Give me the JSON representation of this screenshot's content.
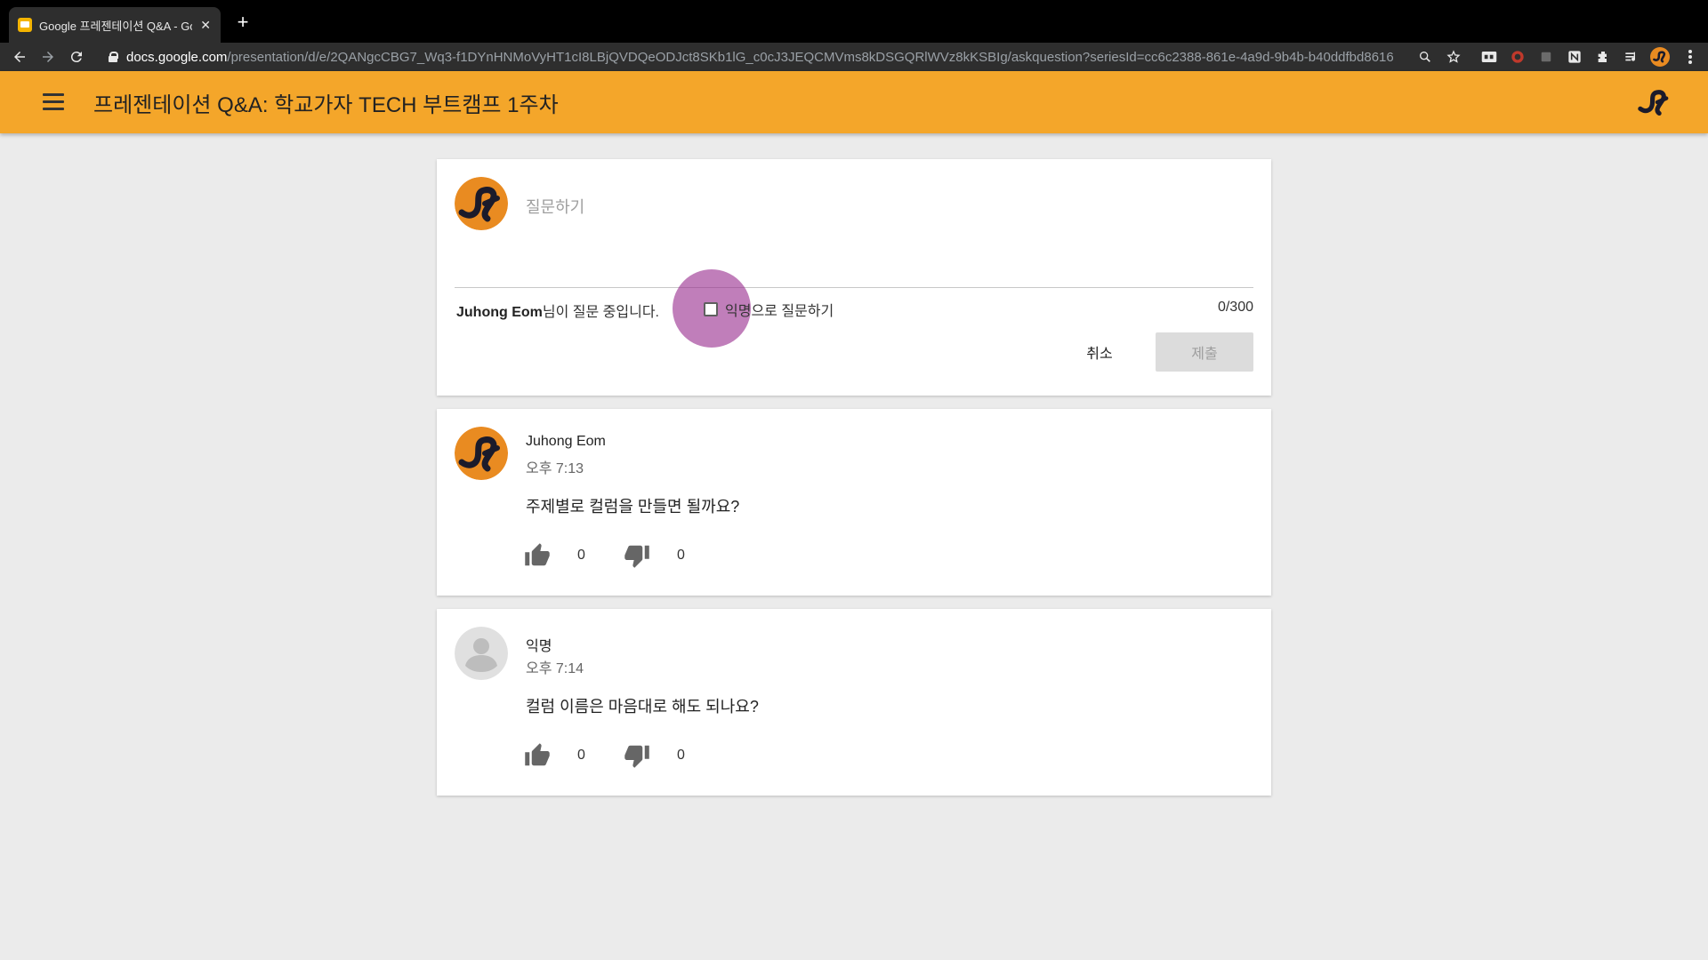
{
  "browser": {
    "tab_title": "Google 프레젠테이션 Q&A - Goog",
    "tab_close": "✕",
    "new_tab": "+",
    "url_host": "docs.google.com",
    "url_path": "/presentation/d/e/2QANgcCBG7_Wq3-f1DYnHNMoVyHT1cI8LBjQVDQeODJct8SKb1lG_c0cJ3JEQCMVms8kDSGQRlWVz8kKSBIg/askquestion?seriesId=cc6c2388-861e-4a9d-9b4b-b40ddfbd8616"
  },
  "header": {
    "title": "프레젠테이션 Q&A: 학교가자 TECH 부트캠프 1주차"
  },
  "ask": {
    "placeholder": "질문하기",
    "asker_name": "Juhong Eom",
    "asker_suffix": "님이 질문 중입니다.",
    "anonymous_label": "익명으로 질문하기",
    "char_count": "0/300",
    "cancel_label": "취소",
    "submit_label": "제출"
  },
  "questions": [
    {
      "author": "Juhong Eom",
      "time": "오후 7:13",
      "text": "주제별로 컬럼을 만들면 될까요?",
      "upvotes": "0",
      "downvotes": "0"
    },
    {
      "author": "익명",
      "time": "오후 7:14",
      "text": "컬럼 이름은 마음대로 해도 되나요?",
      "upvotes": "0",
      "downvotes": "0"
    }
  ],
  "colors": {
    "header_bg": "#f4a62a",
    "page_bg": "#ebebeb",
    "ripple": "#96288c"
  }
}
